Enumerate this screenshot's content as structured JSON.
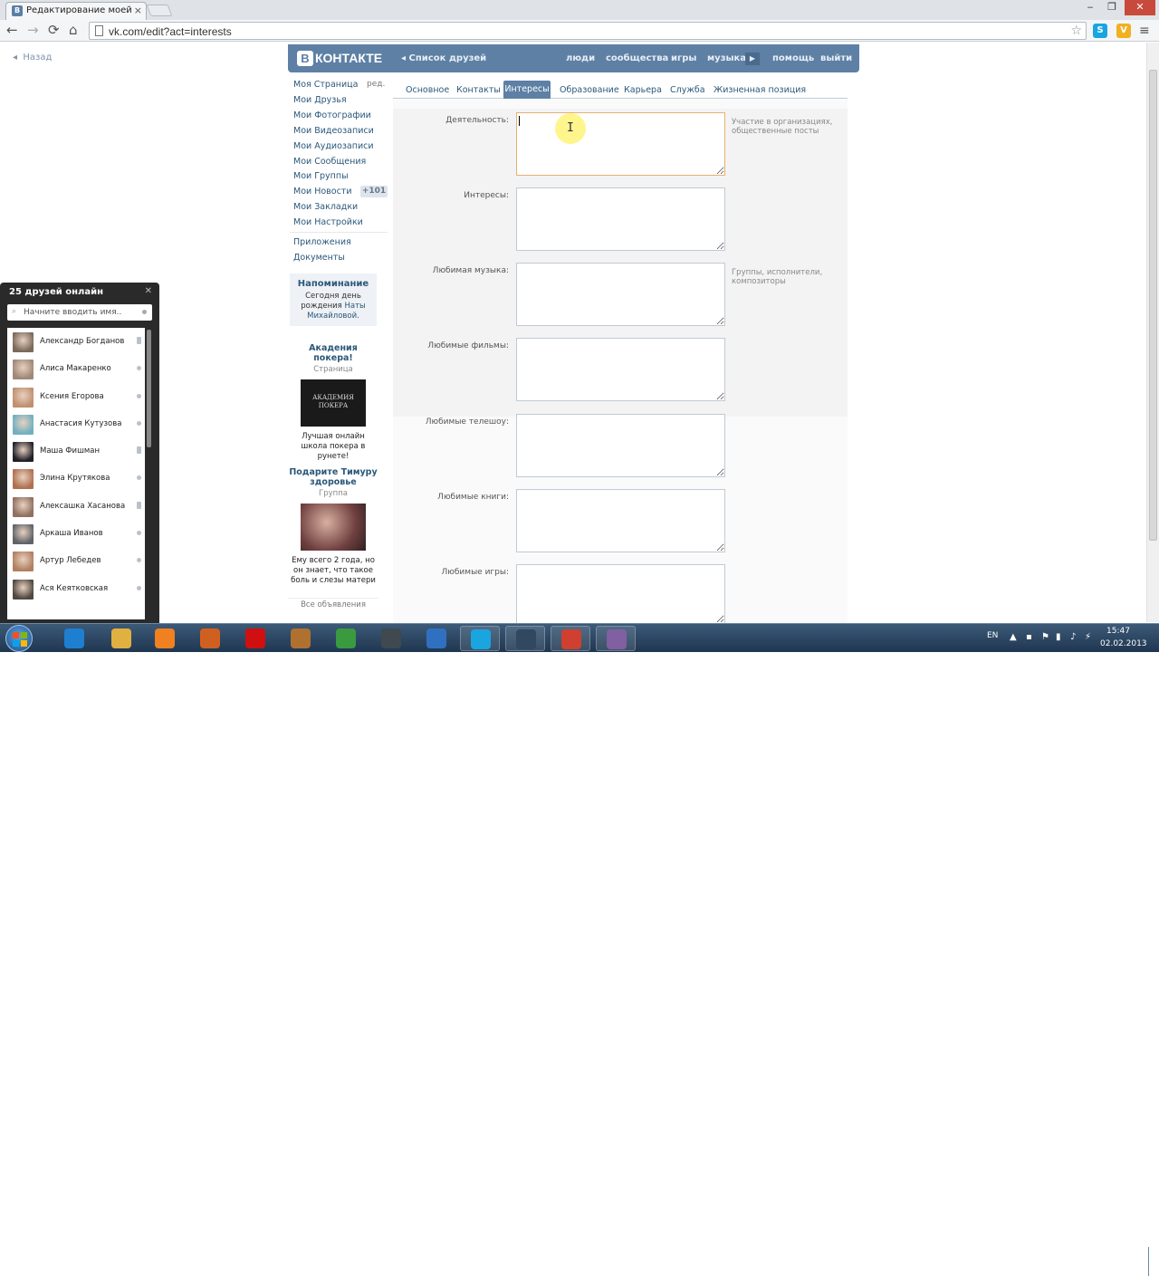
{
  "browser": {
    "tab_title": "Редактирование моей ст",
    "tab_favicon_letter": "В",
    "tab_close": "×",
    "url": "vk.com/edit?act=interests",
    "back": "←",
    "forward": "→",
    "reload": "⟳",
    "home": "⌂",
    "star": "☆",
    "extensions": [
      {
        "name": "skype-ext-icon",
        "color": "#1aa5e0",
        "glyph": "S"
      },
      {
        "name": "shield-ext-icon",
        "color": "#f0b020",
        "glyph": "V"
      }
    ],
    "menu": "≡",
    "win_minimize": "‒",
    "win_maximize": "❐",
    "win_close": "✕"
  },
  "page": {
    "back_link": "Назад"
  },
  "header": {
    "logo_letter": "В",
    "logo_text": "КОНТАКТЕ",
    "friends_list": "Список друзей",
    "links": [
      "люди",
      "сообщества",
      "игры",
      "музыка",
      "помощь",
      "выйти"
    ],
    "play_icon": "▶"
  },
  "left_menu": {
    "items": [
      "Моя Страница",
      "Мои Друзья",
      "Мои Фотографии",
      "Мои Видеозаписи",
      "Мои Аудиозаписи",
      "Мои Сообщения",
      "Мои Группы",
      "Мои Новости",
      "Мои Закладки",
      "Мои Настройки"
    ],
    "edit": "ред.",
    "news_badge": "+101",
    "extra": [
      "Приложения",
      "Документы"
    ]
  },
  "reminder": {
    "title": "Напоминание",
    "text_before": "Сегодня день рождения",
    "name": "Наты Михайловой."
  },
  "ads": [
    {
      "title": "Акадения покера!",
      "sub": "Страница",
      "img_text": "АКАДЕМИЯ ПОКЕРА",
      "desc": "Лучшая онлайн школа покера в рунете!"
    },
    {
      "title": "Подарите Тимуру здоровье",
      "sub": "Группа",
      "img_text": "",
      "desc": "Ему всего 2 года, но он знает, что такое боль и слезы матери"
    }
  ],
  "all_ads": "Все объявления",
  "tabs": [
    "Основное",
    "Контакты",
    "Интересы",
    "Образование",
    "Карьера",
    "Служба",
    "Жизненная позиция"
  ],
  "form": {
    "fields": [
      {
        "label": "Деятельность:",
        "value": "",
        "hint": "Участие в организациях, общественные посты"
      },
      {
        "label": "Интересы:",
        "value": "",
        "hint": ""
      },
      {
        "label": "Любимая музыка:",
        "value": "",
        "hint": "Группы, исполнители, композиторы"
      },
      {
        "label": "Любимые фильмы:",
        "value": "",
        "hint": ""
      },
      {
        "label": "Любимые телешоу:",
        "value": "",
        "hint": ""
      },
      {
        "label": "Любимые книги:",
        "value": "",
        "hint": ""
      },
      {
        "label": "Любимые игры:",
        "value": "",
        "hint": ""
      }
    ]
  },
  "friends": {
    "header": "25 друзей онлайн",
    "close": "✕",
    "search_placeholder": "Начните вводить имя..",
    "search_icon": "⌕",
    "list": [
      {
        "name": "Александр Богданов",
        "mobile": true,
        "color": "#7a6a5a"
      },
      {
        "name": "Алиса Макаренко",
        "mobile": false,
        "color": "#a08878"
      },
      {
        "name": "Ксения Егорова",
        "mobile": false,
        "color": "#c09070"
      },
      {
        "name": "Анастасия Кутузова",
        "mobile": false,
        "color": "#70b0c0"
      },
      {
        "name": "Маша Фишман",
        "mobile": true,
        "color": "#202028"
      },
      {
        "name": "Элина Крутякова",
        "mobile": false,
        "color": "#b07050"
      },
      {
        "name": "Алексашка Хасанова",
        "mobile": true,
        "color": "#907060"
      },
      {
        "name": "Аркаша Иванов",
        "mobile": false,
        "color": "#606468"
      },
      {
        "name": "Артур Лебедев",
        "mobile": false,
        "color": "#b08060"
      },
      {
        "name": "Ася Кеятковская",
        "mobile": false,
        "color": "#504840"
      }
    ]
  },
  "taskbar": {
    "apps": [
      {
        "name": "ie-taskbar-icon",
        "color": "#1e7fd0",
        "pinned": false
      },
      {
        "name": "explorer-taskbar-icon",
        "color": "#e0b040",
        "pinned": false
      },
      {
        "name": "media-player-taskbar-icon",
        "color": "#f08020",
        "pinned": false
      },
      {
        "name": "office-taskbar-icon",
        "color": "#d06020",
        "pinned": false
      },
      {
        "name": "opera-taskbar-icon",
        "color": "#d01010",
        "pinned": false
      },
      {
        "name": "archive-taskbar-icon",
        "color": "#b07030",
        "pinned": false
      },
      {
        "name": "money-taskbar-icon",
        "color": "#3a9a40",
        "pinned": false
      },
      {
        "name": "settings-taskbar-icon",
        "color": "#404850",
        "pinned": false
      },
      {
        "name": "itunes-taskbar-icon",
        "color": "#3070c0",
        "pinned": false
      },
      {
        "name": "skype-taskbar-icon",
        "color": "#1aa5e0",
        "pinned": true
      },
      {
        "name": "monitor-taskbar-icon",
        "color": "#304860",
        "pinned": true
      },
      {
        "name": "chrome-taskbar-icon",
        "color": "#d04030",
        "pinned": true
      },
      {
        "name": "recorder-taskbar-icon",
        "color": "#8060a0",
        "pinned": true
      }
    ],
    "lang": "EN",
    "time": "15:47",
    "date": "02.02.2013"
  }
}
